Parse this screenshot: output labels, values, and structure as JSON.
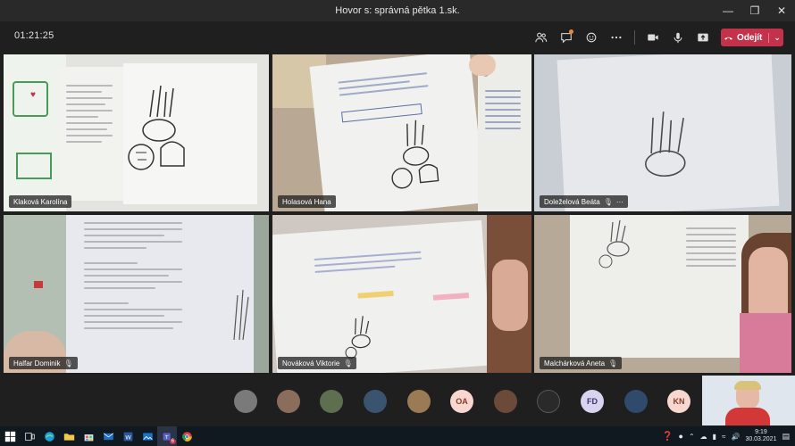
{
  "window": {
    "title": "Hovor s: správná pětka 1.sk."
  },
  "meeting": {
    "timer": "01:21:25",
    "leave_label": "Odejít"
  },
  "participants": [
    {
      "name": "Klaková Karolína",
      "muted": false
    },
    {
      "name": "Holasová Hana",
      "muted": false
    },
    {
      "name": "Doleželová Beáta",
      "muted": true,
      "more": "···"
    },
    {
      "name": "Halfar Dominik",
      "muted": true
    },
    {
      "name": "Nováková Viktorie",
      "muted": true
    },
    {
      "name": "Malchárková Aneta",
      "muted": true
    }
  ],
  "avatars": [
    {
      "initials": "",
      "color": "#7a7a7a"
    },
    {
      "initials": "",
      "color": "#8a6d5a"
    },
    {
      "initials": "",
      "color": "#5d6f4e"
    },
    {
      "initials": "",
      "color": "#3a5470"
    },
    {
      "initials": "",
      "color": "#9a7b54"
    },
    {
      "initials": "OA",
      "color": "#f7d7cf"
    },
    {
      "initials": "",
      "color": "#6b4a3a"
    },
    {
      "initials": "",
      "color": "#2a2a2a"
    },
    {
      "initials": "FD",
      "color": "#d8d4f0"
    },
    {
      "initials": "",
      "color": "#2f4a6a"
    },
    {
      "initials": "KN",
      "color": "#f7d7cf"
    }
  ],
  "taskbar": {
    "teams_badge": "6",
    "time": "9:19",
    "date": "30.03.2021"
  }
}
